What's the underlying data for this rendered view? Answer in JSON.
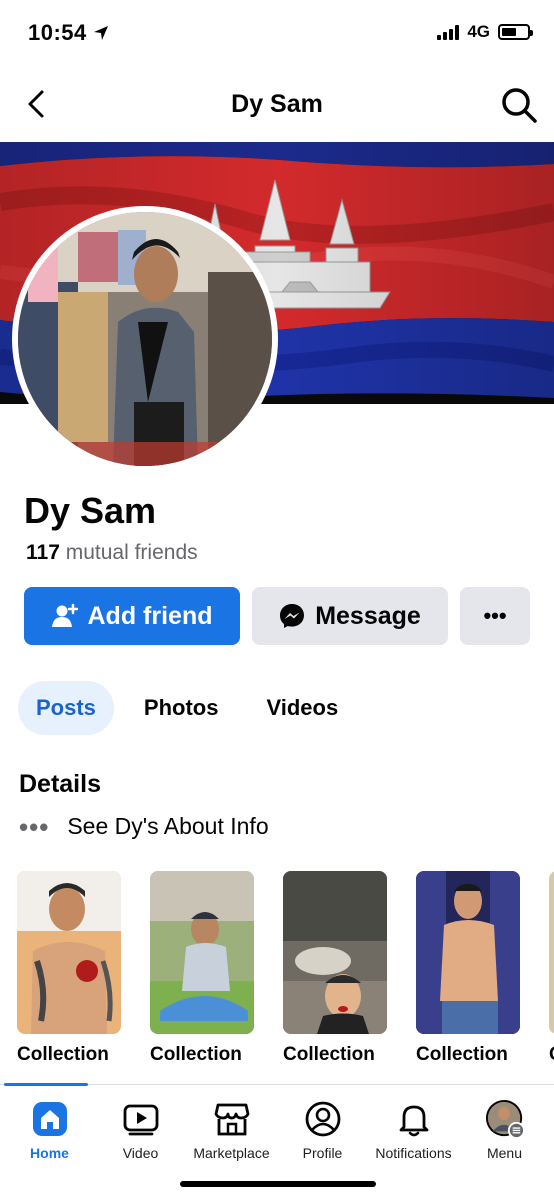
{
  "status_bar": {
    "time": "10:54",
    "network": "4G",
    "battery_level": 0.6
  },
  "header": {
    "title": "Dy Sam",
    "back_icon": "chevron-left-icon",
    "search_icon": "search-icon"
  },
  "profile": {
    "name": "Dy Sam",
    "mutual_count": "117",
    "mutual_label": "mutual friends"
  },
  "actions": {
    "add_friend": "Add friend",
    "message": "Message",
    "more": "•••"
  },
  "tabs": [
    {
      "label": "Posts",
      "active": true
    },
    {
      "label": "Photos",
      "active": false
    },
    {
      "label": "Videos",
      "active": false
    }
  ],
  "details": {
    "title": "Details",
    "about_link": "See Dy's About Info"
  },
  "collections": [
    {
      "label": "Collection"
    },
    {
      "label": "Collection"
    },
    {
      "label": "Collection"
    },
    {
      "label": "Collection"
    },
    {
      "label": "C"
    }
  ],
  "bottom_nav": [
    {
      "label": "Home",
      "icon": "home-icon",
      "active": true
    },
    {
      "label": "Video",
      "icon": "video-icon",
      "active": false
    },
    {
      "label": "Marketplace",
      "icon": "marketplace-icon",
      "active": false
    },
    {
      "label": "Profile",
      "icon": "profile-icon",
      "active": false
    },
    {
      "label": "Notifications",
      "icon": "bell-icon",
      "active": false
    },
    {
      "label": "Menu",
      "icon": "menu-avatar-icon",
      "active": false
    }
  ],
  "colors": {
    "accent": "#1b74e4",
    "secondary_button": "#e4e6eb",
    "active_tab_bg": "#e7f0fd",
    "muted_text": "#65676b"
  }
}
